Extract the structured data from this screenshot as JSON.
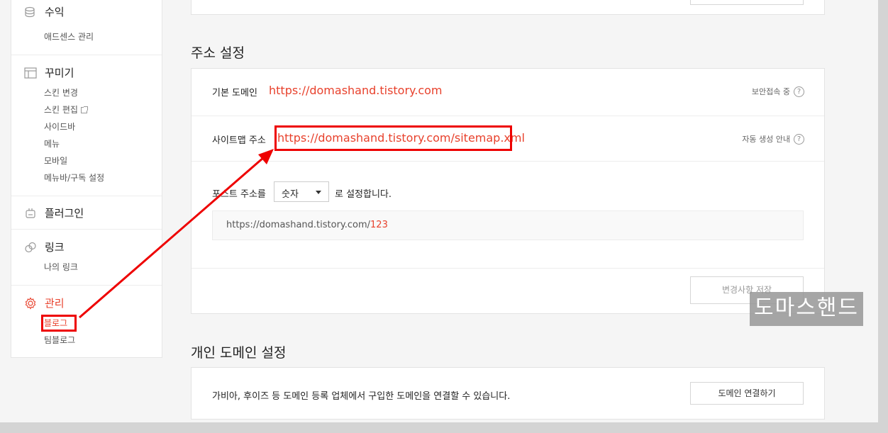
{
  "sidebar": {
    "revenue": {
      "title": "수익",
      "items": [
        "애드센스 관리"
      ]
    },
    "decorate": {
      "title": "꾸미기",
      "items": [
        "스킨 변경",
        "스킨 편집",
        "사이드바",
        "메뉴",
        "모바일",
        "메뉴바/구독 설정"
      ]
    },
    "plugin": {
      "title": "플러그인"
    },
    "link": {
      "title": "링크",
      "items": [
        "나의 링크"
      ]
    },
    "manage": {
      "title": "관리",
      "items": [
        "블로그",
        "팀블로그"
      ]
    }
  },
  "address": {
    "title": "주소 설정",
    "default_domain_label": "기본 도메인",
    "default_domain_value": "https://domashand.tistory.com",
    "secure_label": "보안접속 중",
    "sitemap_label": "사이트맵 주소",
    "sitemap_value": "https://domashand.tistory.com/sitemap.xml",
    "sitemap_help": "자동 생성 안내",
    "post_prefix": "포스트 주소를",
    "post_select": "숫자",
    "post_suffix": "로 설정합니다.",
    "preview_base": "https://domashand.tistory.com/",
    "preview_num": "123",
    "save_button": "변경사항 저장"
  },
  "personal": {
    "title": "개인 도메인 설정",
    "description": "가비아, 후이즈 등 도메인 등록 업체에서 구입한 도메인을 연결할 수 있습니다.",
    "connect_button": "도메인 연결하기"
  },
  "watermark": "도마스핸드",
  "colors": {
    "accent": "#e8412c",
    "annotation": "#ee0000"
  }
}
